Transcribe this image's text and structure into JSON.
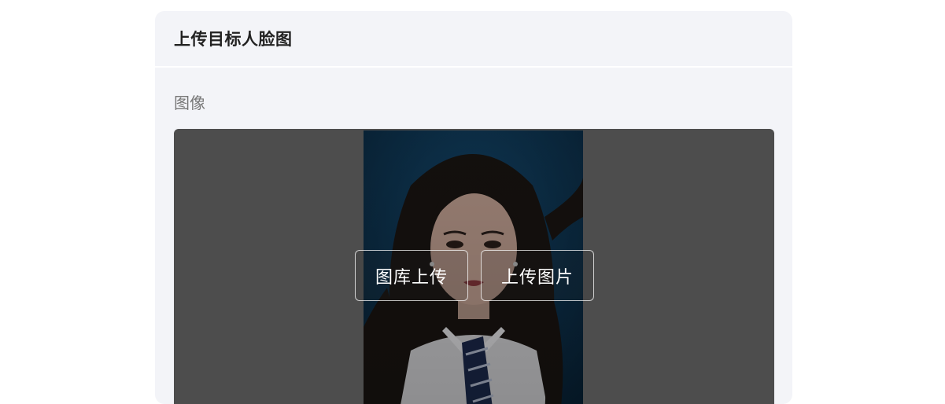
{
  "card": {
    "title": "上传目标人脸图"
  },
  "field": {
    "label": "图像"
  },
  "upload": {
    "gallery_button": "图库上传",
    "upload_button": "上传图片"
  },
  "colors": {
    "card_bg": "#f3f4f8",
    "image_area_bg": "#4d4d4d",
    "photo_bg": "#0f3a5a"
  }
}
